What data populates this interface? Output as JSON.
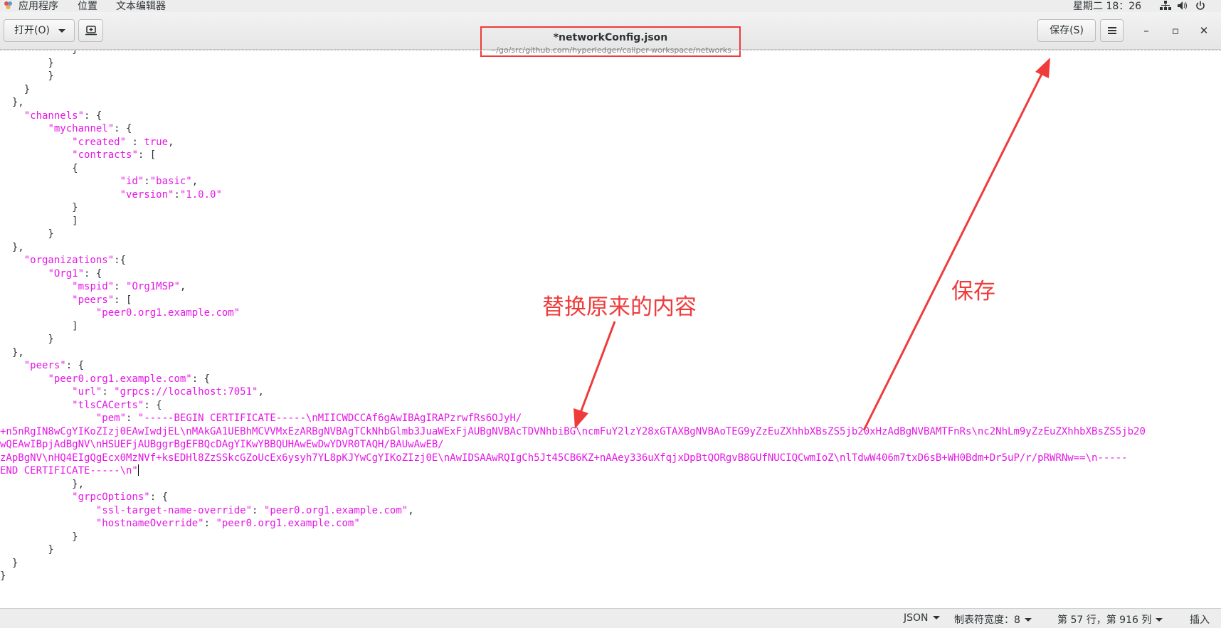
{
  "topbar": {
    "apps": "应用程序",
    "places": "位置",
    "text_editor": "文本编辑器",
    "clock": "星期二 18：26"
  },
  "header": {
    "open_label": "打开(O)",
    "title": "*networkConfig.json",
    "subtitle": "~/go/src/github.com/hyperledger/caliper-workspace/networks",
    "save_label": "保存(S)",
    "menu_icon": "hamburger-icon",
    "minimize": "–",
    "maximize": "▫",
    "close": "✕"
  },
  "editor": {
    "lines": [
      "            }",
      "        }",
      "",
      "        }",
      "    }",
      "},",
      "\"channels\": {",
      "    \"mychannel\": {",
      "        \"created\" : true,",
      "        \"contracts\": [",
      "        {",
      "                \"id\":\"basic\",",
      "                \"version\":\"1.0.0\"",
      "        }",
      "        ]",
      "    }",
      "},",
      "\"organizations\":{",
      "    \"Org1\": {",
      "        \"mspid\": \"Org1MSP\",",
      "        \"peers\": [",
      "            \"peer0.org1.example.com\"",
      "        ]",
      "    }",
      "},",
      "\"peers\": {",
      "    \"peer0.org1.example.com\": {",
      "        \"url\": \"grpcs://localhost:7051\",",
      "        \"tlsCACerts\": {",
      "            \"pem\": \"-----BEGIN CERTIFICATE-----\\nMIICWDCCAf6gAwIBAgIRAPzrwfRs6OJyH/",
      "+n5nRgIN8wCgYIKoZIzj0EAwIwdjEL\\nMAkGA1UEBhMCVVMxEzARBgNVBAgTCkNhbGlmb3JuaWExFjAUBgNVBAcTDVNhbiBG\\ncmFuY2lzY28xGTAXBgNVBAoTEG9yZzEuZXhhbXBsZS5jb20xHzAdBgNVBAMTFnRs\\nc2NhLm9yZzEuZXhhbXBsZS5jb20",
      "wQEAwIBpjAdBgNV\\nHSUEFjAUBggrBgEFBQcDAgYIKwYBBQUHAwEwDwYDVR0TAQH/BAUwAwEB/",
      "zApBgNV\\nHQ4EIgQgEcx0MzNVf+ksEDHl8ZzSSkcGZoUcEx6ysyh7YL8pKJYwCgYIKoZIzj0E\\nAwIDSAAwRQIgCh5Jt45CB6KZ+nAAey336uXfqjxDpBtQORgvB8GUfNUCIQCwmIoZ\\nlTdwW406m7txD6sB+WH0Bdm+Dr5uP/r/pRWRNw==\\n-----",
      "END CERTIFICATE-----\\n\"",
      "        },",
      "        \"grpcOptions\": {",
      "            \"ssl-target-name-override\": \"peer0.org1.example.com\",",
      "            \"hostnameOverride\": \"peer0.org1.example.com\"",
      "        }",
      "    }",
      "}",
      "}"
    ]
  },
  "statusbar": {
    "language": "JSON",
    "tab_width": "制表符宽度：8",
    "position": "第 57 行，第 916 列",
    "mode": "插入"
  },
  "annotations": {
    "replace_note": "替换原来的内容",
    "save_note": "保存"
  },
  "colors": {
    "string": "#e616e6",
    "annotation": "#ef3b3b"
  }
}
